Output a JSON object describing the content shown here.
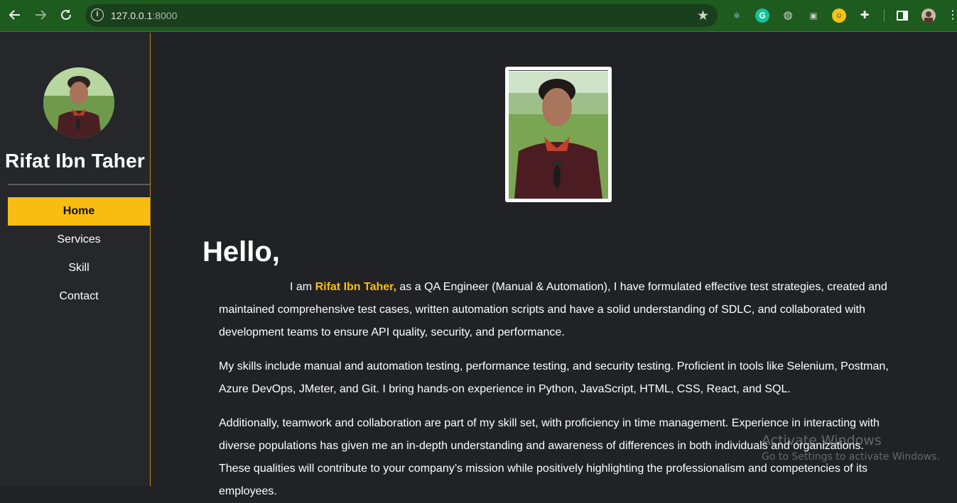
{
  "browser": {
    "url_host": "127.0.0.1",
    "url_port": ":8000",
    "icons": [
      "back-icon",
      "forward-icon",
      "reload-icon",
      "site-info-icon",
      "bookmark-star-icon",
      "react-devtools-icon",
      "grammarly-icon",
      "globe-extension-icon",
      "camera-extension-icon",
      "emoji-extension-icon",
      "extensions-puzzle-icon",
      "side-panel-icon",
      "profile-avatar",
      "menu-kebab-icon"
    ]
  },
  "sidebar": {
    "name": "Rifat Ibn Taher",
    "menu": [
      "Home",
      "Services",
      "Skill",
      "Contact"
    ],
    "active": "Home",
    "accent": "#f9bd11"
  },
  "main": {
    "greeting": "Hello,",
    "p1_before": "I am ",
    "p1_name": "Rifat Ibn Taher,",
    "p1_after": " as a QA Engineer (Manual & Automation), I have formulated effective test strategies, created and maintained comprehensive test cases, written automation scripts and have a solid understanding of SDLC, and collaborated with development teams to ensure API quality, security, and performance.",
    "p2": "My skills include manual and automation testing, performance testing, and security testing. Proficient in tools like Selenium, Postman, Azure DevOps, JMeter, and Git. I bring hands-on experience in Python, JavaScript, HTML, CSS, React, and SQL.",
    "p3": "Additionally, teamwork and collaboration are part of my skill set, with proficiency in time management. Experience in interacting with diverse populations has given me an in-depth understanding and awareness of differences in both individuals and organizations. These qualities will contribute to your company’s mission while positively highlighting the professionalism and competencies of its employees."
  },
  "watermark": {
    "line1": "Activate Windows",
    "line2": "Go to Settings to activate Windows."
  }
}
